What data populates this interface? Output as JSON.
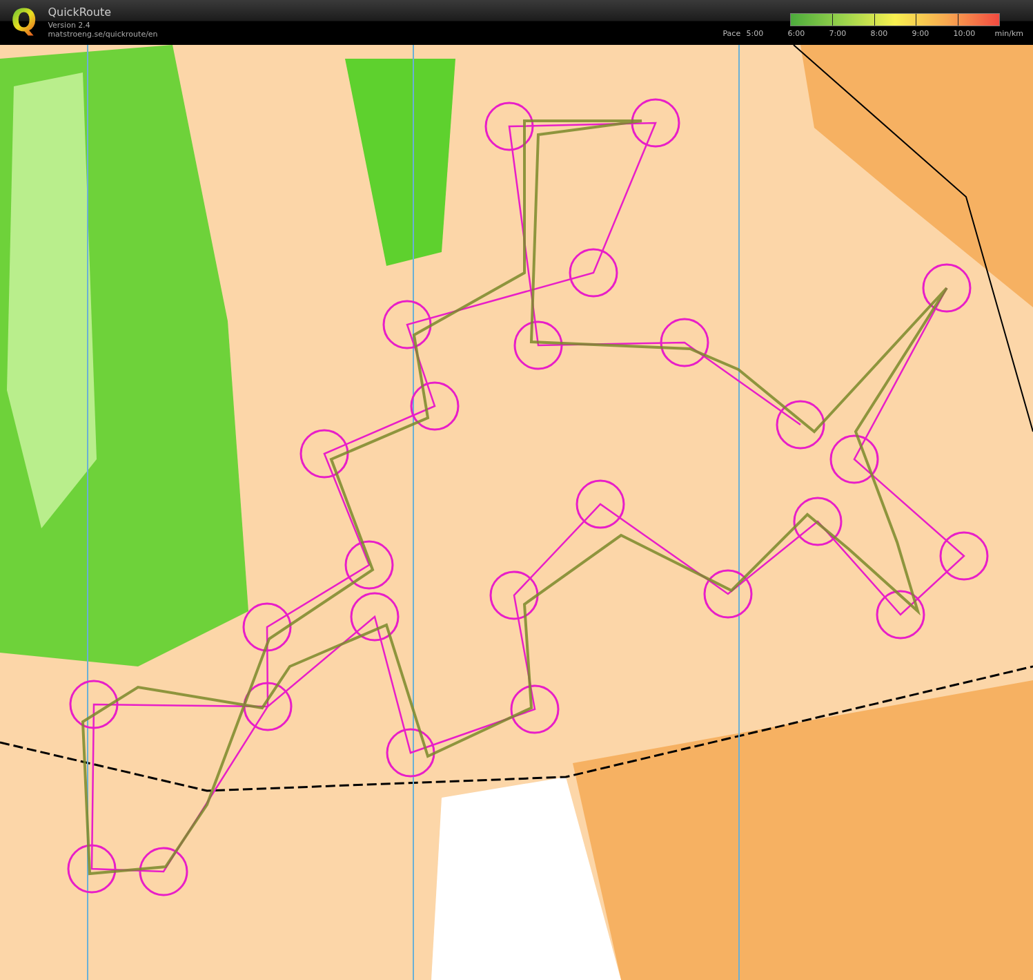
{
  "header": {
    "logo": "Q",
    "title": "QuickRoute",
    "version": "Version 2.4",
    "url": "matstroeng.se/quickroute/en"
  },
  "pace_legend": {
    "label": "Pace",
    "ticks": [
      "5:00",
      "6:00",
      "7:00",
      "8:00",
      "9:00",
      "10:00"
    ],
    "unit": "min/km"
  }
}
